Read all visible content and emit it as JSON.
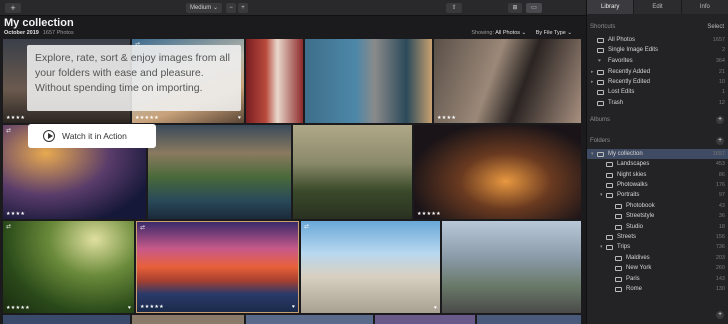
{
  "toolbar": {
    "add": "+",
    "size": "Medium ⌄",
    "minus": "−",
    "plus": "+",
    "share": "⇧",
    "grid": "⊞",
    "single": "▭"
  },
  "header": {
    "title": "My collection",
    "date": "October 2019",
    "count": "1657 Photos",
    "showing_label": "Showing:",
    "showing_value": "All Photos ⌄",
    "filetype": "By File Type ⌄"
  },
  "promo": {
    "text": "Explore, rate, sort & enjoy images from all your folders with ease and pleasure. Without spending time on importing.",
    "watch": "Watch it in Action"
  },
  "tiles": {
    "r1_1_stars": "★★★★",
    "r1_2_stars": "★★★★★",
    "r1_2_heart": "♥",
    "r1_5_stars": "★★★★",
    "r2_1_stars": "★★★★",
    "r2_4_stars": "★★★★★",
    "r3_1_stars": "★★★★★",
    "r3_1_heart": "♥",
    "r3_2_stars": "★★★★★",
    "r3_2_heart": "♥",
    "r3_3_heart": "♥",
    "edit_glyph": "⇄"
  },
  "sidebar": {
    "tabs": [
      "Library",
      "Edit",
      "Info"
    ],
    "shortcuts_title": "Shortcuts",
    "select": "Select",
    "shortcuts": [
      {
        "label": "All Photos",
        "count": "1657"
      },
      {
        "label": "Single Image Edits",
        "count": "2"
      },
      {
        "label": "Favorites",
        "count": "364"
      },
      {
        "label": "Recently Added",
        "count": "21"
      },
      {
        "label": "Recently Edited",
        "count": "10"
      },
      {
        "label": "Lost Edits",
        "count": "1"
      },
      {
        "label": "Trash",
        "count": "12"
      }
    ],
    "albums_title": "Albums",
    "folders_title": "Folders",
    "folders": [
      {
        "label": "My collection",
        "count": "1657"
      },
      {
        "label": "Landscapes",
        "count": "453"
      },
      {
        "label": "Night skies",
        "count": "86"
      },
      {
        "label": "Photowalks",
        "count": "176"
      },
      {
        "label": "Portraits",
        "count": "97"
      },
      {
        "label": "Photobook",
        "count": "43"
      },
      {
        "label": "Streetstyle",
        "count": "36"
      },
      {
        "label": "Studio",
        "count": "18"
      },
      {
        "label": "Streets",
        "count": "156"
      },
      {
        "label": "Trips",
        "count": "736"
      },
      {
        "label": "Maldives",
        "count": "203"
      },
      {
        "label": "New York",
        "count": "260"
      },
      {
        "label": "Paris",
        "count": "143"
      },
      {
        "label": "Rome",
        "count": "130"
      }
    ]
  },
  "icons": {
    "plus": "plus-icon",
    "star": "star-icon",
    "heart": "heart-icon"
  }
}
